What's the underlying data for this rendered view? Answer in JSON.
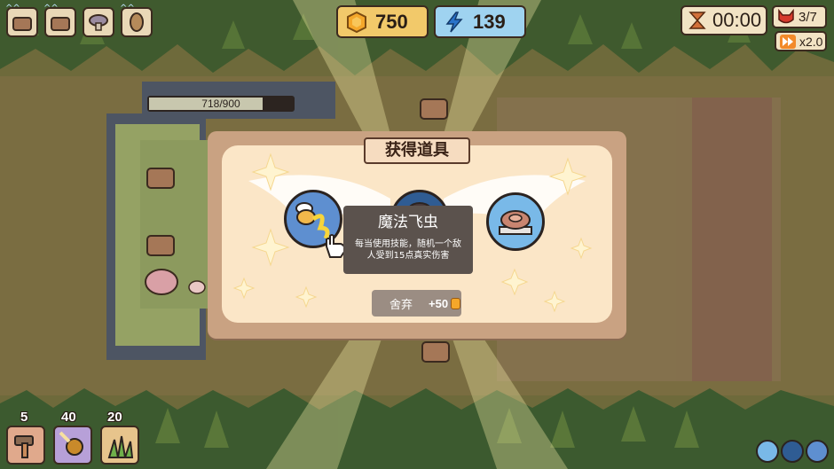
{
  "hud": {
    "top_slots": [
      {
        "name": "tower-slot-1",
        "level": "^^"
      },
      {
        "name": "tower-slot-2",
        "level": "^^"
      },
      {
        "name": "mushroom-slot",
        "level": ""
      },
      {
        "name": "coin-slot",
        "level": "^^"
      }
    ],
    "gold": "750",
    "energy": "139",
    "timer": "00:00",
    "wave": "3/7",
    "speed": "x2.0"
  },
  "base": {
    "health": "718/900",
    "health_fraction": 0.79
  },
  "modal": {
    "title": "获得道具",
    "item_name": "魔法飞虫",
    "item_desc": "每当使用技能，随机一个敌人受到15点真实伤害",
    "discard_label": "舍弃",
    "discard_value": "+50"
  },
  "build_bar": [
    {
      "cost": "5",
      "icon": "hammer-icon"
    },
    {
      "cost": "40",
      "icon": "meteor-icon"
    },
    {
      "cost": "20",
      "icon": "grass-icon"
    }
  ],
  "colors": {
    "gold_panel": "#f2c96a",
    "energy_panel": "#9fd3f0",
    "modal_bg": "#fbe6c7",
    "tooltip_bg": "#5b524d"
  }
}
